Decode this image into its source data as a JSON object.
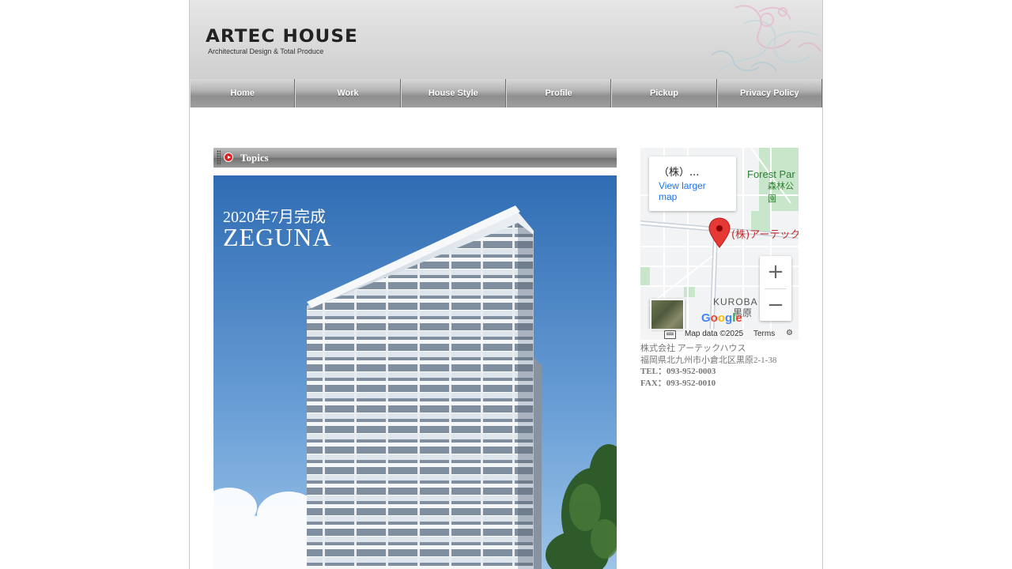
{
  "header": {
    "logo_main": "ARTEC HOUSE",
    "logo_sub": "Architectural Design & Total Produce"
  },
  "nav": {
    "items": [
      {
        "label": "Home"
      },
      {
        "label": "Work"
      },
      {
        "label": "House Style"
      },
      {
        "label": "Profile"
      },
      {
        "label": "Pickup"
      },
      {
        "label": "Privacy Policy"
      }
    ]
  },
  "topics": {
    "label": "Topics"
  },
  "hero": {
    "line1": "2020年7月完成",
    "line2": "ZEGUNA"
  },
  "map": {
    "card_title": "（株）...",
    "card_link": "View larger map",
    "place_forest": "Forest Par",
    "place_forest_jp": "森林公園",
    "pin_label": "(株)アーテック",
    "place_kuroba": "KUROBA",
    "place_kuroba_jp": "黒原",
    "google": "Google",
    "map_data": "Map data ©2025",
    "terms": "Terms",
    "zoom_in": "+",
    "zoom_out": "−"
  },
  "address": {
    "company": "株式会社 アーテックハウス",
    "street": "福岡県北九州市小倉北区黒原2-1-38",
    "tel": "TEL：093-952-0003",
    "fax": "FAX：093-952-0010"
  },
  "colors": {
    "nav_text": "#ffffff",
    "link": "#1a73e8",
    "pin": "#d32f2f",
    "address_text": "#777777"
  }
}
